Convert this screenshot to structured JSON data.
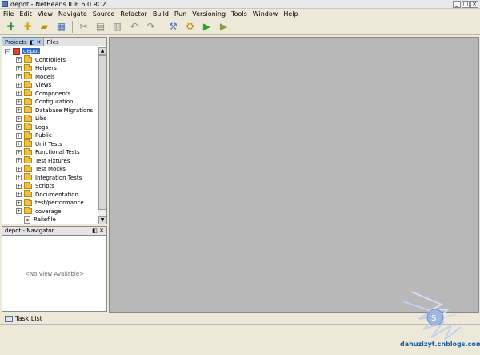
{
  "window": {
    "title": "depot - NetBeans IDE 6.0 RC2",
    "controls": [
      "_",
      "□",
      "×"
    ]
  },
  "menu": [
    "File",
    "Edit",
    "View",
    "Navigate",
    "Source",
    "Refactor",
    "Build",
    "Run",
    "Versioning",
    "Tools",
    "Window",
    "Help"
  ],
  "toolbar": [
    {
      "name": "new-project-icon",
      "glyph": "✚",
      "color": "#2e8b2e"
    },
    {
      "name": "new-file-icon",
      "glyph": "✚",
      "color": "#d4a017"
    },
    {
      "name": "open-project-icon",
      "glyph": "▰",
      "color": "#c98a10"
    },
    {
      "name": "save-all-icon",
      "glyph": "▦",
      "color": "#4a6ea8"
    },
    {
      "sep": true
    },
    {
      "name": "cut-icon",
      "glyph": "✂",
      "color": "#888"
    },
    {
      "name": "copy-icon",
      "glyph": "▤",
      "color": "#888"
    },
    {
      "name": "paste-icon",
      "glyph": "▥",
      "color": "#888"
    },
    {
      "name": "undo-icon",
      "glyph": "↶",
      "color": "#888"
    },
    {
      "name": "redo-icon",
      "glyph": "↷",
      "color": "#888"
    },
    {
      "sep": true
    },
    {
      "name": "build-icon",
      "glyph": "⚒",
      "color": "#5878b8"
    },
    {
      "name": "clean-build-icon",
      "glyph": "⚙",
      "color": "#c98a10"
    },
    {
      "name": "run-icon",
      "glyph": "▶",
      "color": "#2aa52a"
    },
    {
      "name": "debug-icon",
      "glyph": "▶",
      "color": "#8a9a4a"
    }
  ],
  "projects_panel": {
    "tabs": [
      {
        "label": "Projects",
        "active": true
      },
      {
        "label": "Files",
        "active": false
      }
    ],
    "tab_controls": "◧ ✕",
    "root": "depot",
    "items": [
      "Controllers",
      "Helpers",
      "Models",
      "Views",
      "Components",
      "Configuration",
      "Database Migrations",
      "Libs",
      "Logs",
      "Public",
      "Unit Tests",
      "Functional Tests",
      "Test Fixtures",
      "Test Mocks",
      "Integration Tests",
      "Scripts",
      "Documentation",
      "test/performance",
      "coverage"
    ],
    "files": [
      "Rakefile"
    ]
  },
  "navigator_panel": {
    "title": "depot - Navigator",
    "controls": "◧ ✕",
    "message": "<No View Available>"
  },
  "task_list": {
    "label": "Task List"
  },
  "footer": {
    "site_text": "dahuzizyt.cnblogs.com"
  }
}
